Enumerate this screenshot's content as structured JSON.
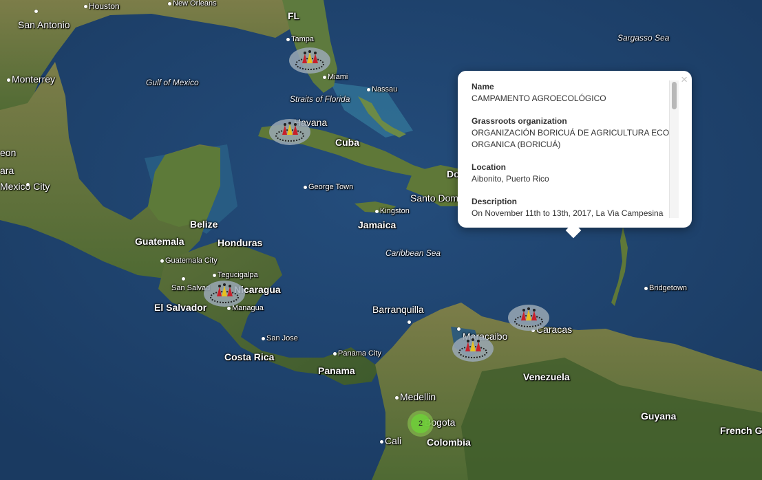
{
  "map": {
    "labels": {
      "houston": "Houston",
      "new_orleans": "New Orleans",
      "san_antonio": "San Antonio",
      "fl": "FL",
      "tampa": "Tampa",
      "miami": "Miami",
      "nassau": "Nassau",
      "straits_of_florida": "Straits of Florida",
      "sargasso_sea": "Sargasso Sea",
      "monterrey": "Monterrey",
      "gulf_of_mexico": "Gulf of Mexico",
      "havana": "Havana",
      "cuba": "Cuba",
      "leon": "eon",
      "ara": "ara",
      "mexico_city": "Mexico City",
      "george_town": "George Town",
      "kingston": "Kingston",
      "jamaica": "Jamaica",
      "santo_domingo": "Santo Dom",
      "do": "Do",
      "belize": "Belize",
      "guatemala": "Guatemala",
      "honduras": "Honduras",
      "guatemala_city": "Guatemala City",
      "tegucigalpa": "Tegucigalpa",
      "san_salvador": "San Salvad",
      "nicaragua": "Nicaragua",
      "el_salvador": "El Salvador",
      "managua": "Managua",
      "caribbean_sea": "Caribbean  Sea",
      "bridgetown": "Bridgetown",
      "barranquilla": "Barranquilla",
      "maracaibo": "Maracaibo",
      "caracas": "Caracas",
      "san_jose": "San Jose",
      "costa_rica": "Costa Rica",
      "panama_city": "Panama City",
      "panama": "Panama",
      "venezuela": "Venezuela",
      "medellin": "Medellin",
      "bogota": "Bogota",
      "cali": "Cali",
      "colombia": "Colombia",
      "guyana": "Guyana",
      "french_guiana": "French G"
    },
    "cluster_count": "2"
  },
  "popup": {
    "close": "×",
    "fields": [
      {
        "label": "Name",
        "value": "CAMPAMENTO AGROECOLÓGICO"
      },
      {
        "label": "Grassroots organization",
        "value": "ORGANIZACIÓN BORICUÁ DE AGRICULTURA ECO-ORGANICA (BORICUÁ)"
      },
      {
        "label": "Location",
        "value": "Aibonito, Puerto Rico"
      },
      {
        "label": "Description",
        "value": "On November 11th to 13th, 2017, La Via Campesina"
      }
    ]
  },
  "colors": {
    "ocean": "#1f4068",
    "land": "#6f7a3e",
    "cluster": "#6ecc39"
  }
}
